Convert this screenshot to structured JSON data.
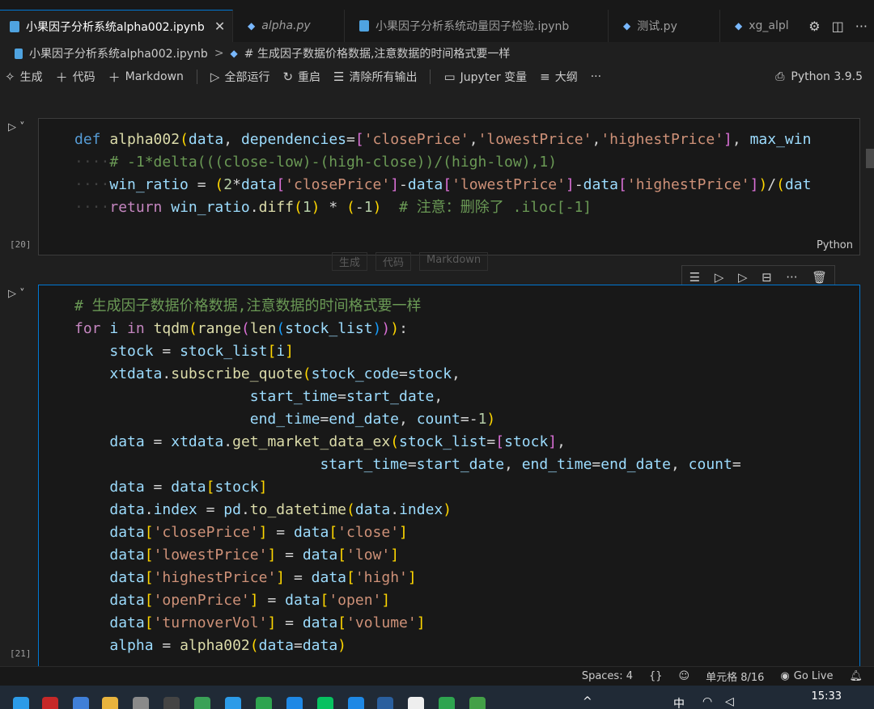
{
  "tabs": [
    {
      "label": "小果因子分析系统alpha002.ipynb",
      "type": "notebook",
      "active": true,
      "close": "✕"
    },
    {
      "label": "alpha.py",
      "type": "python",
      "italic": true
    },
    {
      "label": "小果因子分析系统动量因子检验.ipynb",
      "type": "notebook"
    },
    {
      "label": "测试.py",
      "type": "python"
    },
    {
      "label": "xg_alpl",
      "type": "python"
    }
  ],
  "breadcrumb": {
    "file": "小果因子分析系统alpha002.ipynb",
    "separator": ">",
    "section": "# 生成因子数据价格数据,注意数据的时间格式要一样"
  },
  "toolbar": {
    "generate": "生成",
    "code": "代码",
    "markdown": "Markdown",
    "run_all": "全部运行",
    "restart": "重启",
    "clear_outputs": "清除所有输出",
    "jupyter_vars": "Jupyter 变量",
    "outline": "大纲",
    "more": "···",
    "kernel": "Python 3.9.5"
  },
  "cells": [
    {
      "exec_count": "[20]",
      "language": "Python"
    },
    {
      "exec_count": "[21]"
    }
  ],
  "cell_insert": {
    "generate": "生成",
    "code": "代码",
    "markdown": "Markdown"
  },
  "statusbar": {
    "spaces": "Spaces: 4",
    "braces": "{}",
    "cell_pos": "单元格 8/16",
    "golive": "Go Live"
  },
  "taskbar": {
    "clock": "15:33",
    "ime": "中"
  },
  "colors": {
    "accent": "#0078d4",
    "editor_bg": "#1f1f1f",
    "keyword": "#569cd6",
    "string": "#ce9178",
    "comment": "#6a9955"
  }
}
